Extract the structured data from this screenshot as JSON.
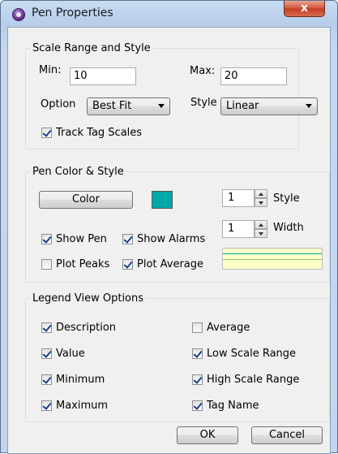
{
  "window": {
    "title": "Pen Properties",
    "close_glyph": "x",
    "icon": "pen-app-icon"
  },
  "scale_range": {
    "legend": "Scale Range and Style",
    "min_label": "Min:",
    "min_value": "10",
    "max_label": "Max:",
    "max_value": "20",
    "option_label": "Option",
    "option_value": "Best Fit",
    "style_label": "Style",
    "style_value": "Linear",
    "track_tag_scales": {
      "label": "Track Tag Scales",
      "checked": true
    }
  },
  "pen_color": {
    "legend": "Pen Color & Style",
    "color_button": "Color",
    "swatch_color": "#00a8a8",
    "style_value": "1",
    "style_label": "Style",
    "width_value": "1",
    "width_label": "Width",
    "show_pen": {
      "label": "Show Pen",
      "checked": true
    },
    "show_alarms": {
      "label": "Show Alarms",
      "checked": true
    },
    "plot_peaks": {
      "label": "Plot Peaks",
      "checked": false
    },
    "plot_average": {
      "label": "Plot Average",
      "checked": true
    },
    "preview_colors": {
      "background": "#ffffc8",
      "line_top": "#00a8a8",
      "line_bottom": "#7ec77e"
    }
  },
  "legend_view": {
    "legend": "Legend View Options",
    "items": [
      {
        "label": "Description",
        "checked": true
      },
      {
        "label": "Average",
        "checked": false
      },
      {
        "label": "Value",
        "checked": true
      },
      {
        "label": "Low Scale Range",
        "checked": true
      },
      {
        "label": "Minimum",
        "checked": true
      },
      {
        "label": "High Scale Range",
        "checked": true
      },
      {
        "label": "Maximum",
        "checked": true
      },
      {
        "label": "Tag Name",
        "checked": true
      }
    ]
  },
  "buttons": {
    "ok": "OK",
    "cancel": "Cancel"
  }
}
